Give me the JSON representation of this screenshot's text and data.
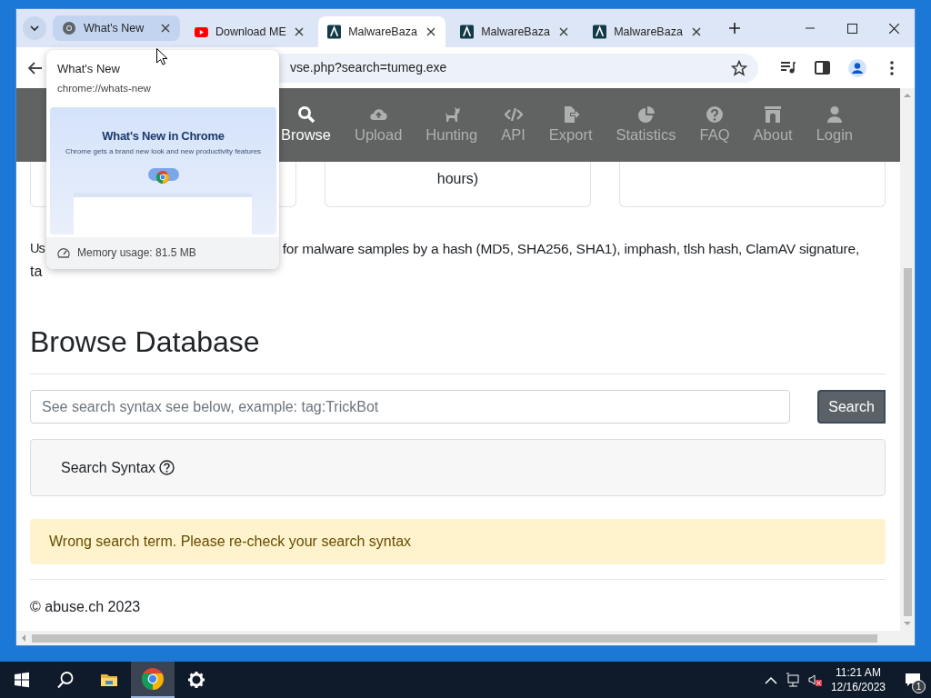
{
  "tabs": [
    {
      "title": "What's New",
      "selected": false,
      "hovered": true
    },
    {
      "title": "Download ME",
      "selected": false,
      "hovered": false
    },
    {
      "title": "MalwareBaza",
      "selected": true,
      "hovered": false
    },
    {
      "title": "MalwareBaza",
      "selected": false,
      "hovered": false
    },
    {
      "title": "MalwareBaza",
      "selected": false,
      "hovered": false
    }
  ],
  "address_bar": {
    "value": "vse.php?search=tumeg.exe"
  },
  "hover_card": {
    "title": "What's New",
    "url": "chrome://whats-new",
    "preview": {
      "heading": "What's New in Chrome",
      "subheading": "Chrome gets a brand new look and new productivity features"
    },
    "memory": "Memory usage: 81.5 MB"
  },
  "navbar": {
    "items": [
      {
        "label": "Browse",
        "selected": true
      },
      {
        "label": "Upload",
        "selected": false
      },
      {
        "label": "Hunting",
        "selected": false
      },
      {
        "label": "API",
        "selected": false
      },
      {
        "label": "Export",
        "selected": false
      },
      {
        "label": "Statistics",
        "selected": false
      },
      {
        "label": "FAQ",
        "selected": false
      },
      {
        "label": "About",
        "selected": false
      },
      {
        "label": "Login",
        "selected": false
      }
    ]
  },
  "stat_cards": [
    {
      "kind": "empty"
    },
    {
      "kind": "text",
      "text": "hours)"
    },
    {
      "kind": "empty"
    }
  ],
  "intro": {
    "line_1_start": "Us",
    "line_1_end": "for malware samples by a hash (MD5, SHA256, SHA1), imphash, tlsh hash, ClamAV signature,",
    "line_2_start": "ta"
  },
  "heading": "Browse Database",
  "search": {
    "placeholder": "See search syntax see below, example: tag:TrickBot",
    "button": "Search"
  },
  "syntax_panel": {
    "label": "Search Syntax"
  },
  "alert": {
    "kind": "warning",
    "text": "Wrong search term. Please re-check your search syntax"
  },
  "footer": "© abuse.ch 2023",
  "taskbar": {
    "apps": [
      {
        "selected": false
      },
      {
        "selected": false
      },
      {
        "selected": false
      },
      {
        "selected": true
      },
      {
        "selected": false
      }
    ],
    "time": "11:21 AM",
    "date": "12/16/2023",
    "notifications": "1"
  }
}
